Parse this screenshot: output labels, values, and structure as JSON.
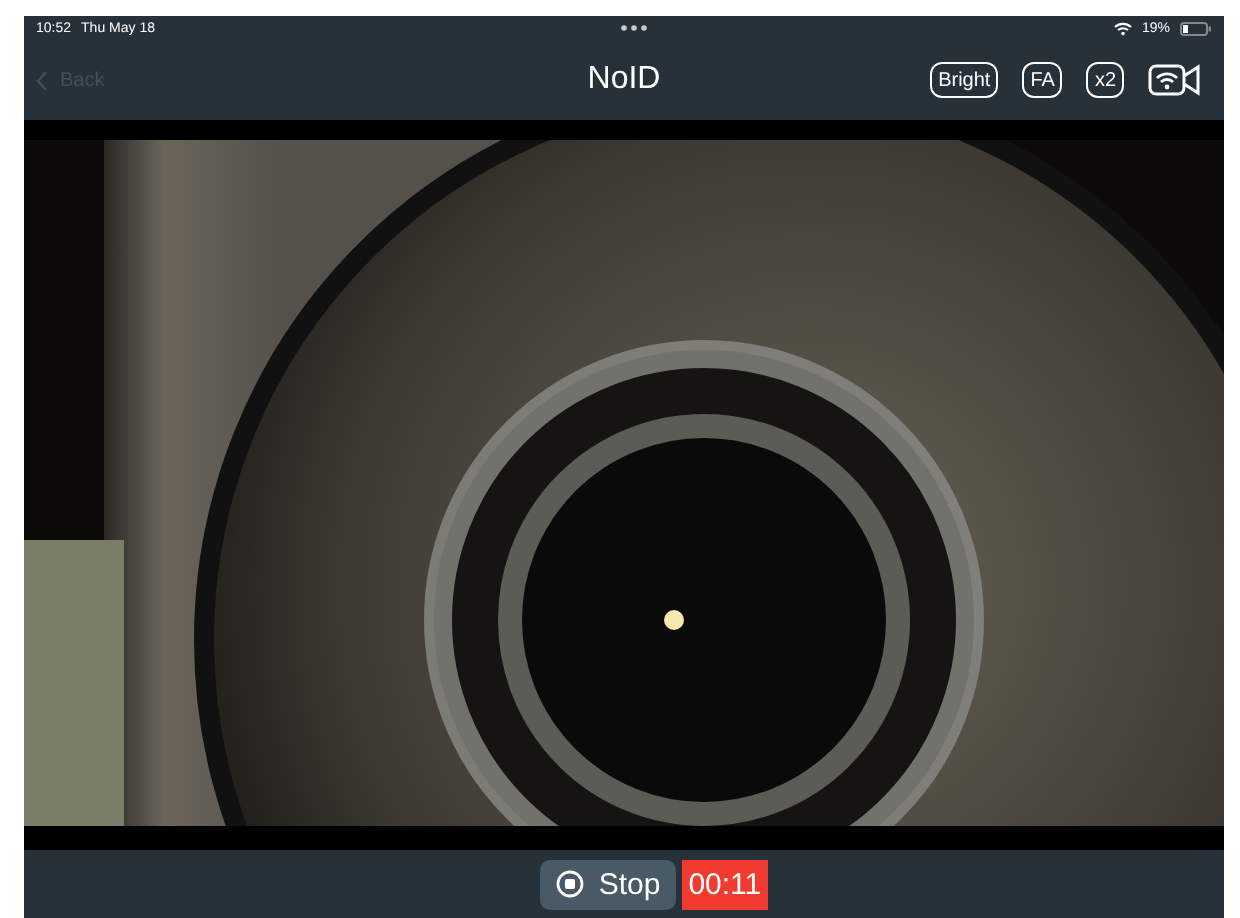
{
  "status_bar": {
    "time": "10:52",
    "date": "Thu May 18",
    "battery_text": "19%"
  },
  "nav_bar": {
    "back": {
      "label": "Back",
      "disabled": true
    },
    "title": "NoID",
    "buttons": [
      {
        "label": "Bright"
      },
      {
        "label": "FA"
      },
      {
        "label": "x2"
      }
    ]
  },
  "recording": {
    "button": "Stop",
    "timer": "00:11"
  }
}
